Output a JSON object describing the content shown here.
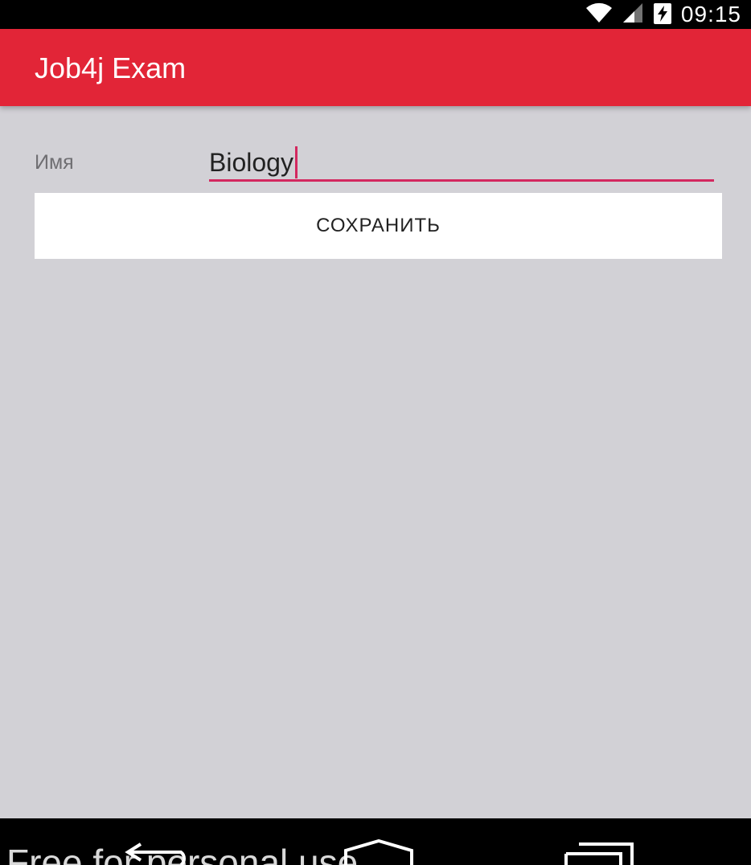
{
  "status_bar": {
    "time": "09:15",
    "icons": [
      "wifi-icon",
      "signal-icon",
      "battery-charging-icon"
    ]
  },
  "app_bar": {
    "title": "Job4j Exam"
  },
  "form": {
    "name_label": "Имя",
    "name_value": "Biology",
    "save_label": "СОХРАНИТЬ"
  },
  "nav_bar": {
    "icons": [
      "back-icon",
      "home-icon",
      "recents-icon"
    ]
  },
  "watermark": "Free for personal use",
  "colors": {
    "app_bar": "#e22537",
    "accent": "#d3285f",
    "background": "#d2d1d6"
  }
}
